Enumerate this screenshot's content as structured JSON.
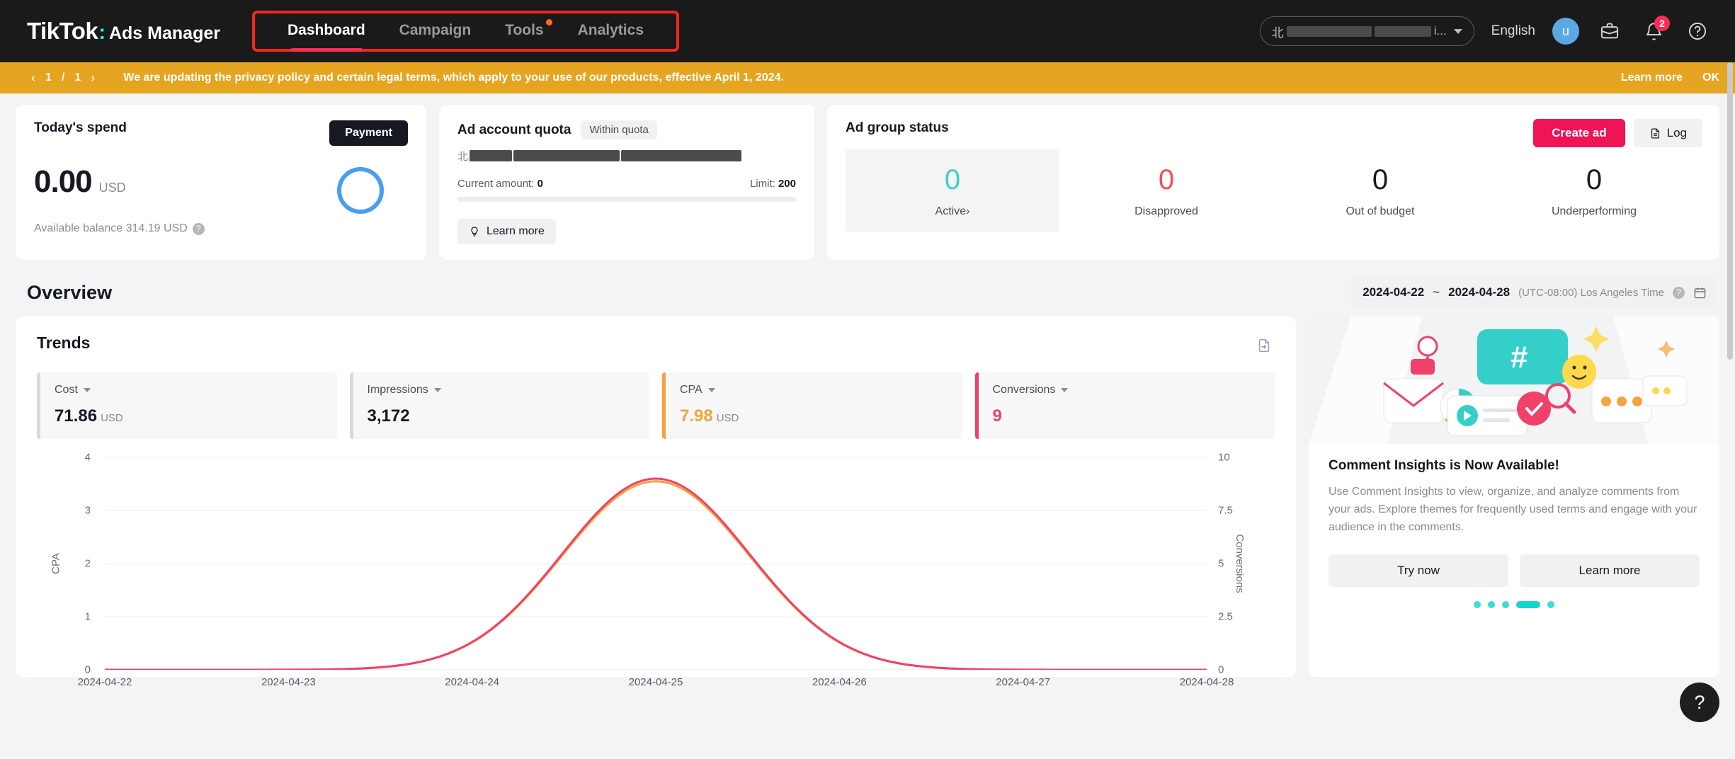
{
  "header": {
    "logo_main": "TikTok",
    "logo_colon": ":",
    "logo_sub": "Ads Manager",
    "nav": [
      {
        "label": "Dashboard",
        "active": true,
        "dot": false
      },
      {
        "label": "Campaign",
        "active": false,
        "dot": false
      },
      {
        "label": "Tools",
        "active": false,
        "dot": true
      },
      {
        "label": "Analytics",
        "active": false,
        "dot": false
      }
    ],
    "account_prefix": "北",
    "account_suffix": "i...",
    "language": "English",
    "avatar_initial": "u",
    "notification_count": "2",
    "icons": [
      "briefcase-icon",
      "bell-icon",
      "help-icon"
    ]
  },
  "banner": {
    "page_current": "1",
    "page_sep": "/",
    "page_total": "1",
    "message": "We are updating the privacy policy and certain legal terms, which apply to your use of our products, effective April 1, 2024.",
    "learn_more": "Learn more",
    "ok": "OK",
    "bg_color": "#e5a520"
  },
  "spend_card": {
    "title": "Today's spend",
    "payment_label": "Payment",
    "amount": "0.00",
    "currency": "USD",
    "balance_text": "Available balance 314.19 USD",
    "ring_color": "#4a9ef0"
  },
  "quota_card": {
    "title": "Ad account quota",
    "badge": "Within quota",
    "account_prefix": "北",
    "current_label": "Current amount:",
    "current_value": "0",
    "limit_label": "Limit:",
    "limit_value": "200",
    "learn_more": "Learn more"
  },
  "status_card": {
    "title": "Ad group status",
    "create_ad": "Create ad",
    "log": "Log",
    "cells": [
      {
        "value": "0",
        "label": "Active",
        "color": "#3bd0c8",
        "selected": true,
        "chevron": "›"
      },
      {
        "value": "0",
        "label": "Disapproved",
        "color": "#fa4b57",
        "selected": false,
        "chevron": ""
      },
      {
        "value": "0",
        "label": "Out of budget",
        "color": "#161823",
        "selected": false,
        "chevron": ""
      },
      {
        "value": "0",
        "label": "Underperforming",
        "color": "#161823",
        "selected": false,
        "chevron": ""
      }
    ]
  },
  "overview": {
    "title": "Overview",
    "date_start": "2024-04-22",
    "date_tilde": "~",
    "date_end": "2024-04-28",
    "timezone": "(UTC-08:00) Los Angeles Time"
  },
  "trends": {
    "title": "Trends",
    "tiles": [
      {
        "name": "Cost",
        "value": "71.86",
        "unit": "USD",
        "accent": "#d9d9dc",
        "value_color": "#161823"
      },
      {
        "name": "Impressions",
        "value": "3,172",
        "unit": "",
        "accent": "#d9d9dc",
        "value_color": "#161823"
      },
      {
        "name": "CPA",
        "value": "7.98",
        "unit": "USD",
        "accent": "#f5a33c",
        "value_color": "#f5a33c"
      },
      {
        "name": "Conversions",
        "value": "9",
        "unit": "",
        "accent": "#f0416a",
        "value_color": "#f0416a"
      }
    ]
  },
  "chart_data": {
    "type": "line",
    "title": "Trends",
    "x": [
      "2024-04-22",
      "2024-04-23",
      "2024-04-24",
      "2024-04-25",
      "2024-04-26",
      "2024-04-27",
      "2024-04-28"
    ],
    "xlabel": "",
    "grid": true,
    "legend": "none",
    "left_axis": {
      "label": "CPA",
      "ticks": [
        "0",
        "1",
        "2",
        "3",
        "4"
      ],
      "ylim": [
        0,
        4
      ]
    },
    "right_axis": {
      "label": "Conversions",
      "ticks": [
        "0",
        "2.5",
        "5",
        "7.5",
        "10"
      ],
      "ylim": [
        0,
        10
      ]
    },
    "series": [
      {
        "name": "CPA",
        "axis": "left",
        "color": "#f5a33c",
        "values": [
          0,
          0,
          0,
          3.55,
          0,
          0,
          0
        ]
      },
      {
        "name": "Conversions",
        "axis": "right",
        "color": "#f0416a",
        "values": [
          0,
          0,
          0,
          9,
          0,
          0,
          0
        ]
      }
    ]
  },
  "promo": {
    "heading": "Comment Insights is Now Available!",
    "body": "Use Comment Insights to view, organize, and analyze comments from your ads. Explore themes for frequently used terms and engage with your audience in the comments.",
    "try_now": "Try now",
    "learn_more": "Learn more",
    "dot_count": 5,
    "dot_active_index": 3,
    "accent": "#16d5cc"
  },
  "fab": {
    "glyph": "?"
  }
}
